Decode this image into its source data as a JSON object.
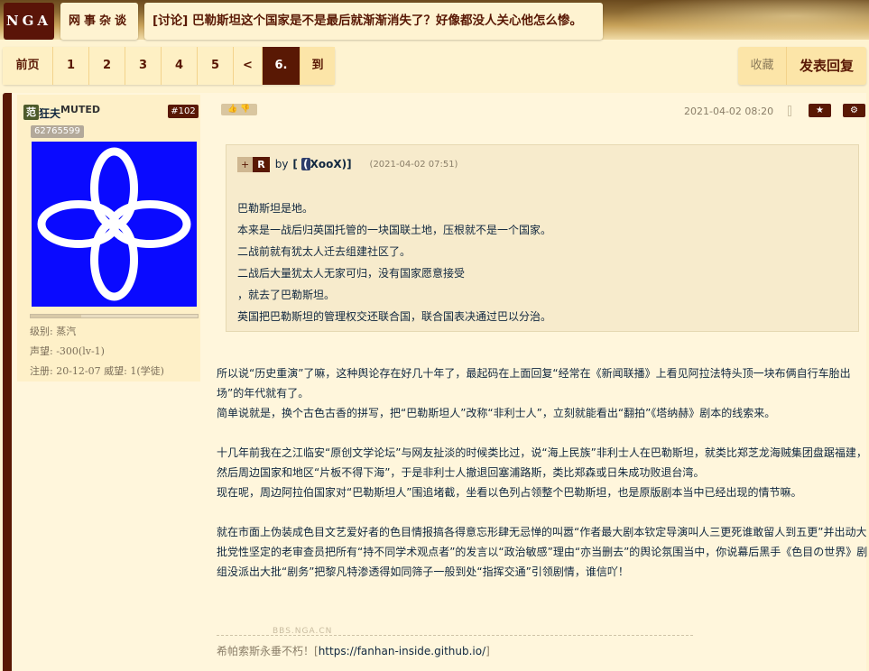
{
  "header": {
    "logo": "NGA",
    "forum": "网事杂谈",
    "topic": "[讨论] 巴勒斯坦这个国家是不是最后就渐渐消失了？好像都没人关心他怎么惨。"
  },
  "pager": {
    "first": "前页",
    "pages": [
      "1",
      "2",
      "3",
      "4",
      "5"
    ],
    "prev": "<",
    "current": "6.",
    "goto": "到"
  },
  "actions": {
    "favorite": "收藏",
    "reply": "发表回复"
  },
  "user": {
    "badge": "范",
    "name": "狂夫",
    "status": "MUTED",
    "floor": "#102",
    "uid": "62765599",
    "level": "级别: 蒸汽",
    "reputation": "声望: -300(lv-1)",
    "register": "注册: 20-12-07  威望: 1(学徒)"
  },
  "post": {
    "thumbs": "👍 👎",
    "date": "2021-04-02 08:20",
    "quote": {
      "plus": "+",
      "r": "R",
      "by": "by",
      "name_left": "[",
      "name_paren": "(",
      "name": "XooX)",
      "name_right": "]",
      "date": "(2021-04-02 07:51)",
      "lines": [
        "巴勒斯坦是地。",
        "本来是一战后归英国托管的一块国联土地，压根就不是一个国家。",
        "二战前就有犹太人迁去组建社区了。",
        "二战后大量犹太人无家可归，没有国家愿意接受",
        "，就去了巴勒斯坦。",
        "英国把巴勒斯坦的管理权交还联合国，联合国表决通过巴以分治。"
      ]
    },
    "paragraphs": [
      "所以说“历史重演”了嘛，这种舆论存在好几十年了，最起码在上面回复“经常在《新闻联播》上看见阿拉法特头顶一块布俩自行车胎出场”的年代就有了。",
      "简单说就是，换个古色古香的拼写，把“巴勒斯坦人”改称“非利士人”，立刻就能看出“翻拍”《塔纳赫》剧本的线索来。",
      "十几年前我在之江临安“原创文学论坛”与网友扯淡的时候类比过，说“海上民族”非利士人在巴勒斯坦，就类比郑芝龙海贼集团盘踞福建，然后周边国家和地区“片板不得下海”，于是非利士人撤退回塞浦路斯，类比郑森或日朱成功败退台湾。",
      "现在呢，周边阿拉伯国家对“巴勒斯坦人”围追堵截，坐看以色列占领整个巴勒斯坦，也是原版剧本当中已经出现的情节嘛。",
      "就在市面上伪装成色目文艺爱好者的色目情报搞各得意忘形肆无忌惮的叫嚣“作者最大剧本钦定导演叫人三更死谁敢留人到五更”并出动大批党性坚定的老审查员把所有“持不同学术观点者”的发言以“政治敏感”理由“亦当删去”的舆论氛围当中，你说幕后黑手《色目の世界》剧组没派出大批“剧务”把黎凡特渗透得如同筛子一般到处“指挥交通”引领剧情，谁信吖！"
    ],
    "watermark": "BBS.NGA.CN",
    "signature_text": "希帕索斯永垂不朽！[",
    "signature_link": "https://fanhan-inside.github.io/",
    "signature_end": "]"
  }
}
